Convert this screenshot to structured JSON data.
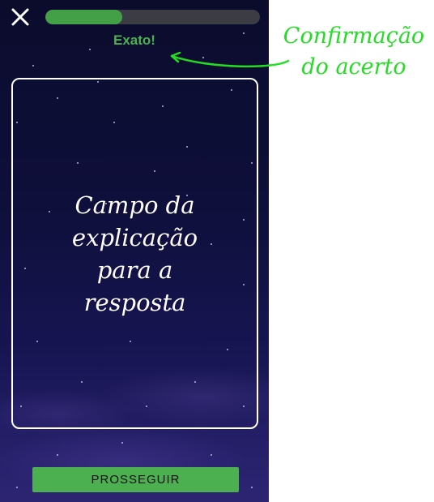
{
  "app": {
    "close_icon": "close-icon",
    "progress_fraction": 0.36,
    "feedback_text": "Exato!",
    "explanation_text": "Campo da explicação para a resposta",
    "continue_label": "PROSSEGUIR"
  },
  "annotation": {
    "text": "Confirmação do acerto",
    "arrow_icon": "curved-arrow-icon"
  },
  "colors": {
    "accent": "#4caf50",
    "annotation": "#22dd22",
    "background_top": "#0b0c2c",
    "background_bottom": "#2d2572",
    "progress_track": "#3c3c44"
  }
}
